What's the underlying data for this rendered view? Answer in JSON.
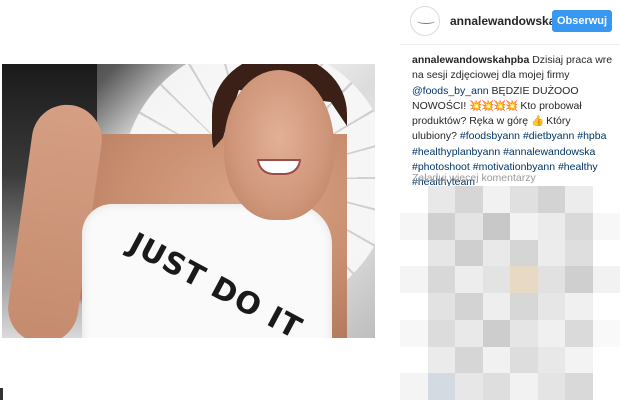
{
  "post": {
    "username": "annalewandowskał",
    "follow_label": "Obserwuj"
  },
  "photo": {
    "shirt_text": "JUST DO IT"
  },
  "caption": {
    "author": "annalewandowskahpba",
    "line1": " Dzisiaj praca wre na sesji zdjęciowej dla mojej firmy ",
    "mention": "@foods_by_ann",
    "line2": " BĘDZIE DUŻOOO NOWOŚCI! ",
    "emojis": "💥💥💥💥",
    "line3": " Kto probował produktów? Ręka w górę ",
    "raised_hand": "👍",
    "line4": " Który ulubiony? ",
    "hashtags": [
      "#foodsbyann",
      "#dietbyann",
      "#hpba",
      "#healthyplanbyann",
      "#annalewandowska",
      "#photoshoot",
      "#motivationbyann",
      "#healthy",
      "#healthyteam"
    ]
  },
  "comments": {
    "load_more_label": "Załaduj więcej komentarzy"
  },
  "colors": {
    "follow_button": "#3897f0",
    "link": "#003569",
    "muted": "#999999"
  },
  "blur_tiles": [
    "#ffffff",
    "#e8e8e8",
    "#d6d6d6",
    "#f1f1f1",
    "#e0e0e0",
    "#d3d3d3",
    "#ececec",
    "#ffffff",
    "#f6f6f6",
    "#d0d0d0",
    "#e4e4e4",
    "#c8c8c8",
    "#f2f2f2",
    "#ebebeb",
    "#d9d9d9",
    "#f7f7f7",
    "#ffffff",
    "#e6e6e6",
    "#cfcfcf",
    "#e9e9e9",
    "#d5d5d5",
    "#ececec",
    "#dedede",
    "#ffffff",
    "#f4f4f4",
    "#d8d8d8",
    "#ededed",
    "#e3e3e3",
    "#e8d9c4",
    "#e1e1e1",
    "#cfcfcf",
    "#f2f2f2",
    "#ffffff",
    "#e2e2e2",
    "#d3d3d3",
    "#eeeeee",
    "#d7d7d7",
    "#e6e6e6",
    "#f0f0f0",
    "#ffffff",
    "#f7f7f7",
    "#dcdcdc",
    "#e9e9e9",
    "#cdcdcd",
    "#e5e5e5",
    "#f0f0f0",
    "#dadada",
    "#f9f9f9",
    "#ffffff",
    "#ebebeb",
    "#d6d6d6",
    "#f1f1f1",
    "#dddddd",
    "#e8e8e8",
    "#f3f3f3",
    "#ffffff",
    "#f4f4f4",
    "#d4dae2",
    "#e7e7e7",
    "#dedede",
    "#f2f2f2",
    "#e4e4e4",
    "#d9d9d9",
    "#ffffff"
  ]
}
